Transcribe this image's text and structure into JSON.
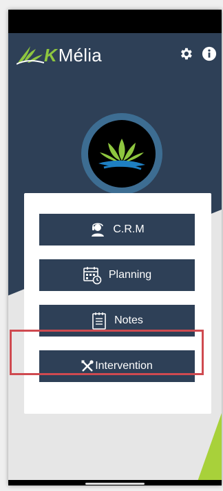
{
  "app": {
    "brand_prefix": "K",
    "brand_name": "Mélia",
    "icons": {
      "settings": "gear-icon",
      "info": "info-icon"
    }
  },
  "menu": [
    {
      "label": "C.R.M",
      "icon": "customer-support-icon"
    },
    {
      "label": "Planning",
      "icon": "calendar-clock-icon"
    },
    {
      "label": "Notes",
      "icon": "notepad-icon"
    },
    {
      "label": "Intervention",
      "icon": "tools-icon"
    }
  ],
  "colors": {
    "navy": "#2e4057",
    "accent_green": "#8ec63f",
    "highlight_red": "#cf4a50",
    "avatar_ring": "#3d6d92"
  }
}
